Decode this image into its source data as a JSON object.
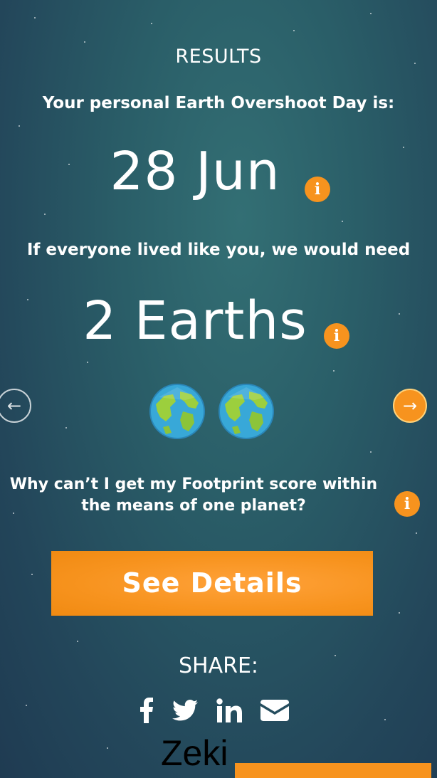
{
  "header": {
    "title": "RESULTS"
  },
  "overshoot": {
    "label": "Your personal Earth Overshoot Day is:",
    "date": "28 Jun",
    "info_glyph": "i"
  },
  "earths": {
    "label": "If everyone lived like you, we would need",
    "count": "2 Earths",
    "info_glyph": "i",
    "earth_icon_count": 2
  },
  "carousel": {
    "prev_glyph": "←",
    "next_glyph": "→"
  },
  "why": {
    "line1": "Why can’t I get my Footprint score within",
    "line2": "the means of one planet?",
    "info_glyph": "i"
  },
  "actions": {
    "see_details_label": "See Details"
  },
  "share": {
    "label": "SHARE:",
    "icons": [
      "facebook-icon",
      "twitter-icon",
      "linkedin-icon",
      "email-icon"
    ]
  },
  "overlay": {
    "watermark": "Zeki"
  },
  "colors": {
    "accent": "#f7931e",
    "background_top": "#336f74",
    "background_bottom": "#1f3b52",
    "text": "#ffffff"
  }
}
